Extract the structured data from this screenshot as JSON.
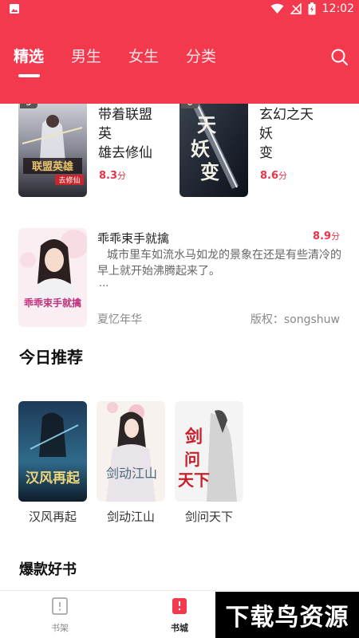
{
  "status_bar": {
    "time": "12:02"
  },
  "tabs": [
    {
      "label": "精选",
      "active": true
    },
    {
      "label": "男生",
      "active": false
    },
    {
      "label": "女生",
      "active": false
    },
    {
      "label": "分类",
      "active": false
    }
  ],
  "top_cards": [
    {
      "rank": "5",
      "title_line1": "带着联盟英",
      "title_line2": "雄去修仙",
      "score": "8.3",
      "unit": "分"
    },
    {
      "rank": "6",
      "title_line1": "玄幻之天妖",
      "title_line2": "变",
      "score": "8.6",
      "unit": "分"
    }
  ],
  "featured_book": {
    "title": "乖乖束手就擒",
    "score": "8.9",
    "unit": "分",
    "description": "城市里车如流水马如龙的景象在还是有些清冷的早上就开始沸腾起来了。",
    "ellipsis": "...",
    "author": "夏忆年华",
    "copyright": "版权：songshuw",
    "cover_text": "乖乖束手就擒"
  },
  "today_section": {
    "title": "今日推荐",
    "books": [
      {
        "title": "汉风再起"
      },
      {
        "title": "剑动江山"
      },
      {
        "title": "剑问天下"
      }
    ]
  },
  "hot_section": {
    "title": "爆款好书"
  },
  "bottom_nav": [
    {
      "label": "书架",
      "icon": "bookshelf-icon",
      "active": false
    },
    {
      "label": "书城",
      "icon": "bookstore-icon",
      "active": true
    }
  ],
  "watermark": "下载鸟资源",
  "colors": {
    "brand": "#f2394e",
    "score": "#e5364a"
  }
}
